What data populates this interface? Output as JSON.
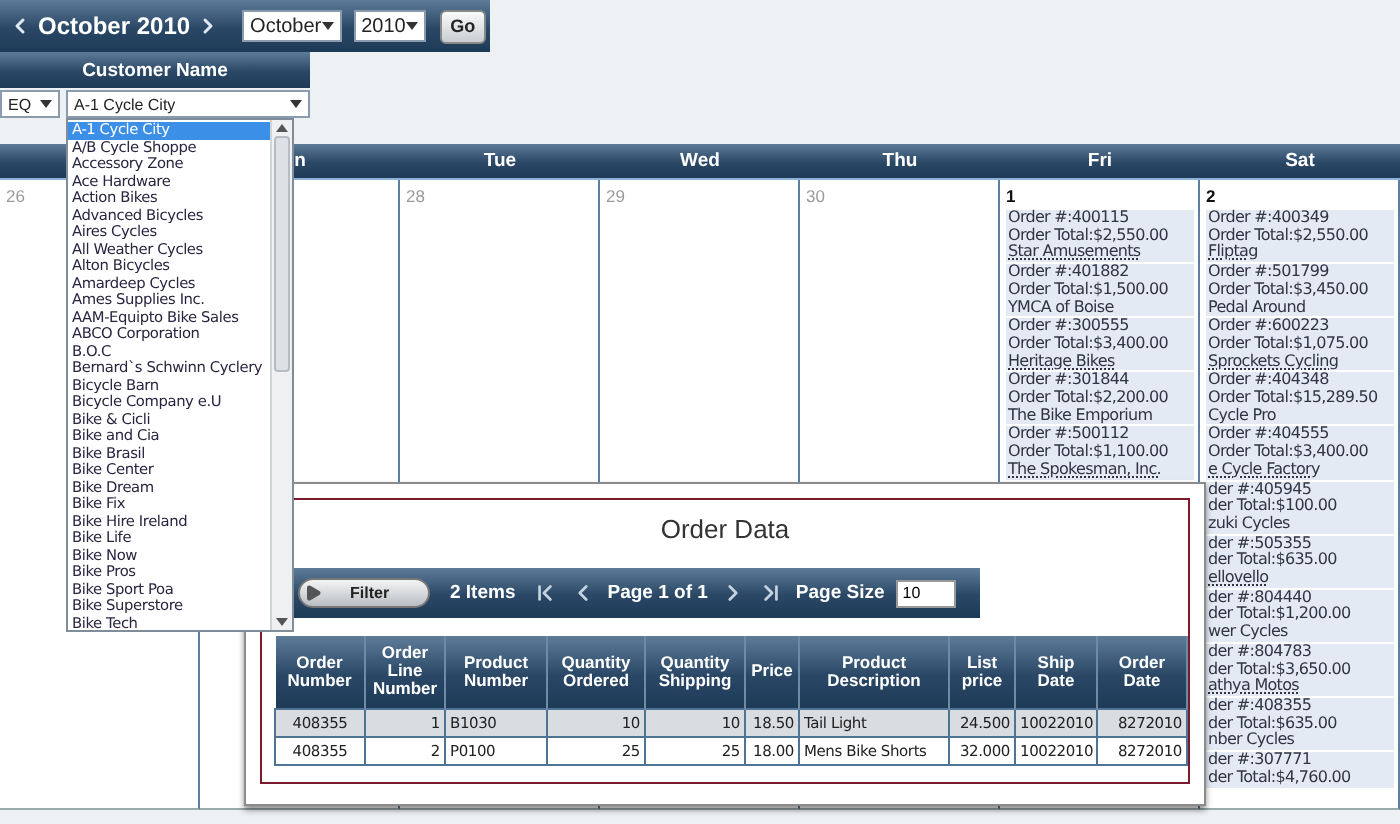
{
  "header": {
    "title": "October 2010",
    "month": "October",
    "year": "2010",
    "go": "Go"
  },
  "filter": {
    "column": "Customer Name",
    "operator": "EQ",
    "value": "A-1 Cycle City",
    "options": [
      {
        "label": "A-1 Cycle City",
        "selected": true
      },
      {
        "label": "A/B Cycle Shoppe",
        "selected": false
      },
      {
        "label": "Accessory Zone",
        "selected": false
      },
      {
        "label": "Ace Hardware",
        "selected": false
      },
      {
        "label": "Action Bikes",
        "selected": false
      },
      {
        "label": "Advanced Bicycles",
        "selected": false
      },
      {
        "label": "Aires Cycles",
        "selected": false
      },
      {
        "label": "All Weather Cycles",
        "selected": false
      },
      {
        "label": "Alton Bicycles",
        "selected": false
      },
      {
        "label": "Amardeep Cycles",
        "selected": false
      },
      {
        "label": "Ames Supplies Inc.",
        "selected": false
      },
      {
        "label": "AAM-Equipto Bike Sales",
        "selected": false
      },
      {
        "label": "ABCO Corporation",
        "selected": false
      },
      {
        "label": "B.O.C",
        "selected": false
      },
      {
        "label": "Bernard`s Schwinn Cyclery",
        "selected": false
      },
      {
        "label": "Bicycle Barn",
        "selected": false
      },
      {
        "label": "Bicycle Company e.U",
        "selected": false
      },
      {
        "label": "Bike & Cicli",
        "selected": false
      },
      {
        "label": "Bike and Cia",
        "selected": false
      },
      {
        "label": "Bike Brasil",
        "selected": false
      },
      {
        "label": "Bike Center",
        "selected": false
      },
      {
        "label": "Bike Dream",
        "selected": false
      },
      {
        "label": "Bike Fix",
        "selected": false
      },
      {
        "label": "Bike Hire Ireland",
        "selected": false
      },
      {
        "label": "Bike Life",
        "selected": false
      },
      {
        "label": "Bike Now",
        "selected": false
      },
      {
        "label": "Bike Pros",
        "selected": false
      },
      {
        "label": "Bike Sport Poa",
        "selected": false
      },
      {
        "label": "Bike Superstore",
        "selected": false
      },
      {
        "label": "Bike Tech",
        "selected": false
      }
    ]
  },
  "calendar": {
    "days": [
      {
        "label": "n"
      },
      {
        "label": "Tue"
      },
      {
        "label": "Wed"
      },
      {
        "label": "Thu"
      },
      {
        "label": "Fri"
      },
      {
        "label": "Sat"
      }
    ],
    "cells": [
      {
        "date": "26",
        "other_month": true
      },
      {},
      {
        "date": "28",
        "other_month": true
      },
      {
        "date": "29",
        "other_month": true
      },
      {
        "date": "30",
        "other_month": true
      },
      {
        "date": "1",
        "other_month": false,
        "orders": [
          {
            "number": "Order #:400115",
            "total": "Order Total:$2,550.00",
            "customer": "Star Amusements"
          },
          {
            "number": "Order #:401882",
            "total": "Order Total:$1,500.00",
            "customer": "YMCA of Boise"
          },
          {
            "number": "Order #:300555",
            "total": "Order Total:$3,400.00",
            "customer": "Heritage Bikes"
          },
          {
            "number": "Order #:301844",
            "total": "Order Total:$2,200.00",
            "customer": "The Bike Emporium"
          },
          {
            "number": "Order #:500112",
            "total": "Order Total:$1,100.00",
            "customer": "The Spokesman, Inc."
          }
        ]
      },
      {
        "date": "2",
        "other_month": false,
        "orders": [
          {
            "number": "Order #:400349",
            "total": "Order Total:$2,550.00",
            "customer": "Fliptag"
          },
          {
            "number": "Order #:501799",
            "total": "Order Total:$3,450.00",
            "customer": "Pedal Around"
          },
          {
            "number": "Order #:600223",
            "total": "Order Total:$1,075.00",
            "customer": "Sprockets Cycling"
          },
          {
            "number": "Order #:404348",
            "total": "Order Total:$15,289.50",
            "customer": "Cycle Pro"
          },
          {
            "number": "Order #:404555",
            "total": "Order Total:$3,400.00",
            "customer": "e Cycle Factory"
          },
          {
            "number": "der #:405945",
            "total": "der Total:$100.00",
            "customer": "zuki Cycles"
          },
          {
            "number": "der #:505355",
            "total": "der Total:$635.00",
            "customer": "ellovello"
          },
          {
            "number": "der #:804440",
            "total": "der Total:$1,200.00",
            "customer": "wer Cycles"
          },
          {
            "number": "der #:804783",
            "total": "der Total:$3,650.00",
            "customer": "athya Motos"
          },
          {
            "number": "der #:408355",
            "total": "der Total:$635.00",
            "customer": "nber Cycles"
          },
          {
            "number": "der #:307771",
            "total": "der Total:$4,760.00"
          }
        ]
      }
    ]
  },
  "modal": {
    "title": "Order Data",
    "toolbar": {
      "filter": "Filter",
      "items": "2 Items",
      "page": "Page 1 of 1",
      "page_size_label": "Page Size",
      "page_size": "10"
    },
    "columns": [
      {
        "label": "Order Number",
        "kind": "id"
      },
      {
        "label": "Order Line Number",
        "kind": "number"
      },
      {
        "label": "Product Number",
        "kind": "text"
      },
      {
        "label": "Quantity Ordered",
        "kind": "number"
      },
      {
        "label": "Quantity Shipping",
        "kind": "number"
      },
      {
        "label": "Price",
        "kind": "number"
      },
      {
        "label": "Product Description",
        "kind": "text"
      },
      {
        "label": "List price",
        "kind": "number"
      },
      {
        "label": "Ship Date",
        "kind": "number"
      },
      {
        "label": "Order Date",
        "kind": "number"
      }
    ],
    "rows": [
      {
        "selected": true,
        "cells": [
          "408355",
          "1",
          "B1030",
          "10",
          "10",
          "18.50",
          "Tail Light",
          "24.500",
          "10022010",
          "8272010"
        ]
      },
      {
        "selected": false,
        "cells": [
          "408355",
          "2",
          "P0100",
          "25",
          "25",
          "18.00",
          "Mens Bike Shorts",
          "32.000",
          "10022010",
          "8272010"
        ]
      }
    ]
  }
}
